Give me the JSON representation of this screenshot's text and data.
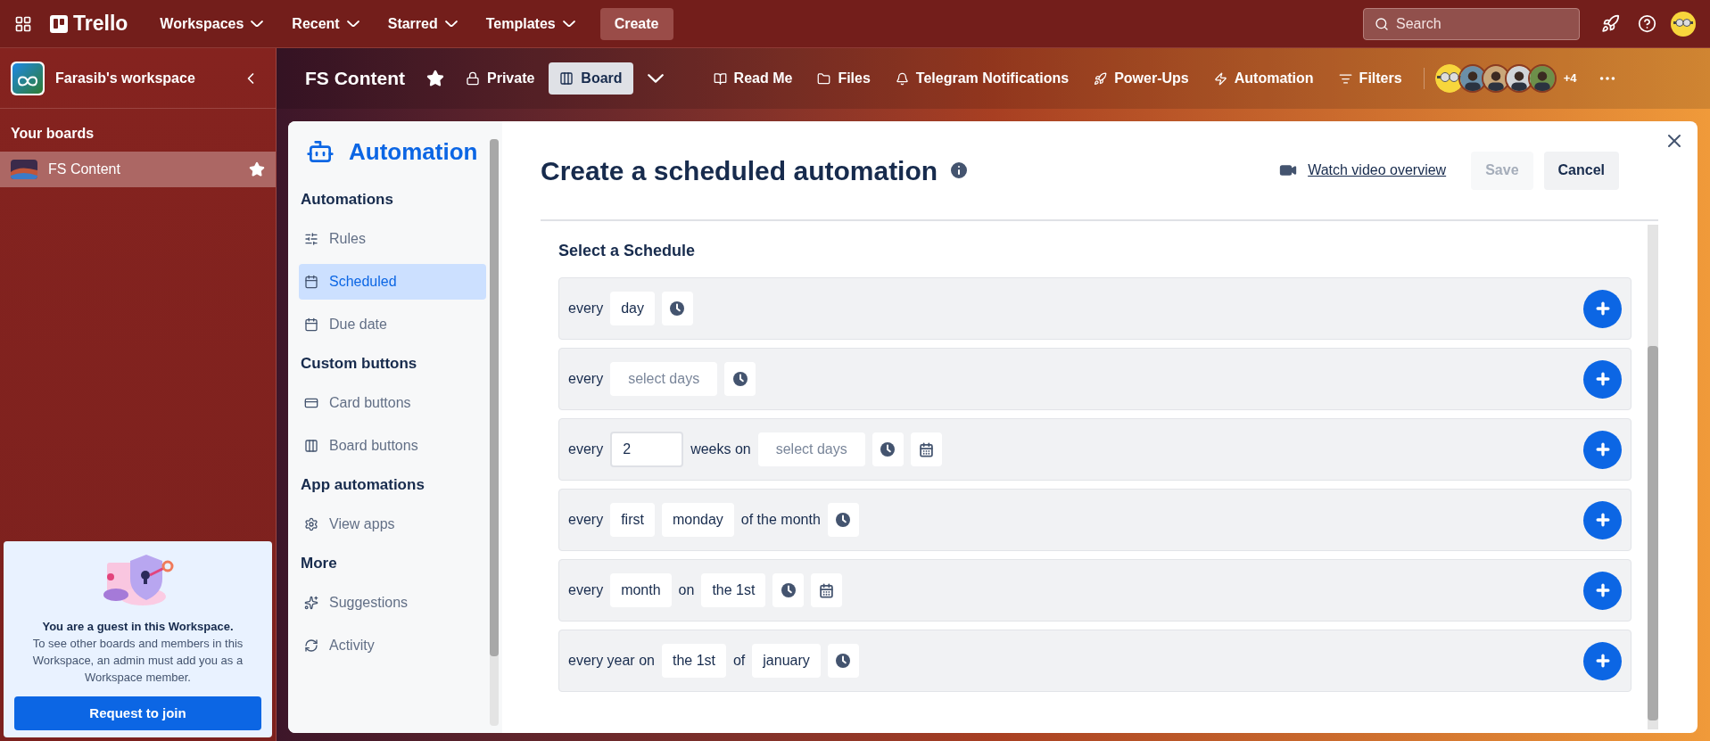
{
  "topbar": {
    "logo": "Trello",
    "menus": [
      {
        "label": "Workspaces"
      },
      {
        "label": "Recent"
      },
      {
        "label": "Starred"
      },
      {
        "label": "Templates"
      }
    ],
    "create": "Create",
    "search": {
      "placeholder": "Search"
    }
  },
  "sidebar": {
    "workspace": "Farasib's workspace",
    "section": "Your boards",
    "boards": [
      {
        "name": "FS Content",
        "selected": true,
        "starred": true
      }
    ],
    "guest": {
      "title": "You are a guest in this Workspace.",
      "text": "To see other boards and members in this Workspace, an admin must add you as a Workspace member.",
      "button": "Request to join"
    }
  },
  "board": {
    "title": "FS Content",
    "starred": true,
    "visibility": "Private",
    "view": "Board",
    "items": [
      {
        "label": "Read Me"
      },
      {
        "label": "Files"
      },
      {
        "label": "Telegram Notifications"
      },
      {
        "label": "Power-Ups"
      },
      {
        "label": "Automation"
      },
      {
        "label": "Filters"
      }
    ],
    "member_count": "+4"
  },
  "modal": {
    "nav_title": "Automation",
    "nav": [
      {
        "kind": "heading",
        "label": "Automations"
      },
      {
        "kind": "item",
        "label": "Rules",
        "selected": false
      },
      {
        "kind": "item",
        "label": "Scheduled",
        "selected": true
      },
      {
        "kind": "item",
        "label": "Due date",
        "selected": false
      },
      {
        "kind": "heading",
        "label": "Custom buttons"
      },
      {
        "kind": "item",
        "label": "Card buttons",
        "selected": false
      },
      {
        "kind": "item",
        "label": "Board buttons",
        "selected": false
      },
      {
        "kind": "heading",
        "label": "App automations"
      },
      {
        "kind": "item",
        "label": "View apps",
        "selected": false
      },
      {
        "kind": "heading",
        "label": "More"
      },
      {
        "kind": "item",
        "label": "Suggestions",
        "selected": false
      },
      {
        "kind": "item",
        "label": "Activity",
        "selected": false
      }
    ],
    "title": "Create a scheduled automation",
    "video_link": "Watch video overview",
    "save": {
      "label": "Save",
      "disabled": true
    },
    "cancel": "Cancel",
    "section": "Select a Schedule",
    "rows": [
      {
        "parts": [
          {
            "kind": "text",
            "text": "every"
          },
          {
            "kind": "select",
            "text": "day"
          },
          {
            "kind": "clock"
          }
        ]
      },
      {
        "parts": [
          {
            "kind": "text",
            "text": "every"
          },
          {
            "kind": "select",
            "placeholder": "select days"
          },
          {
            "kind": "clock"
          }
        ]
      },
      {
        "parts": [
          {
            "kind": "text",
            "text": "every"
          },
          {
            "kind": "input",
            "text": "2"
          },
          {
            "kind": "text",
            "text": "weeks on"
          },
          {
            "kind": "select",
            "placeholder": "select days"
          },
          {
            "kind": "clock"
          },
          {
            "kind": "calendar"
          }
        ]
      },
      {
        "parts": [
          {
            "kind": "text",
            "text": "every"
          },
          {
            "kind": "select",
            "text": "first"
          },
          {
            "kind": "select",
            "text": "monday"
          },
          {
            "kind": "text",
            "text": "of the month"
          },
          {
            "kind": "clock"
          }
        ]
      },
      {
        "parts": [
          {
            "kind": "text",
            "text": "every"
          },
          {
            "kind": "select",
            "text": "month"
          },
          {
            "kind": "text",
            "text": "on"
          },
          {
            "kind": "select",
            "text": "the 1st"
          },
          {
            "kind": "clock"
          },
          {
            "kind": "calendar"
          }
        ]
      },
      {
        "parts": [
          {
            "kind": "text",
            "text": "every year on"
          },
          {
            "kind": "select",
            "text": "the 1st"
          },
          {
            "kind": "text",
            "text": "of"
          },
          {
            "kind": "select",
            "text": "january"
          },
          {
            "kind": "clock"
          }
        ]
      }
    ]
  }
}
